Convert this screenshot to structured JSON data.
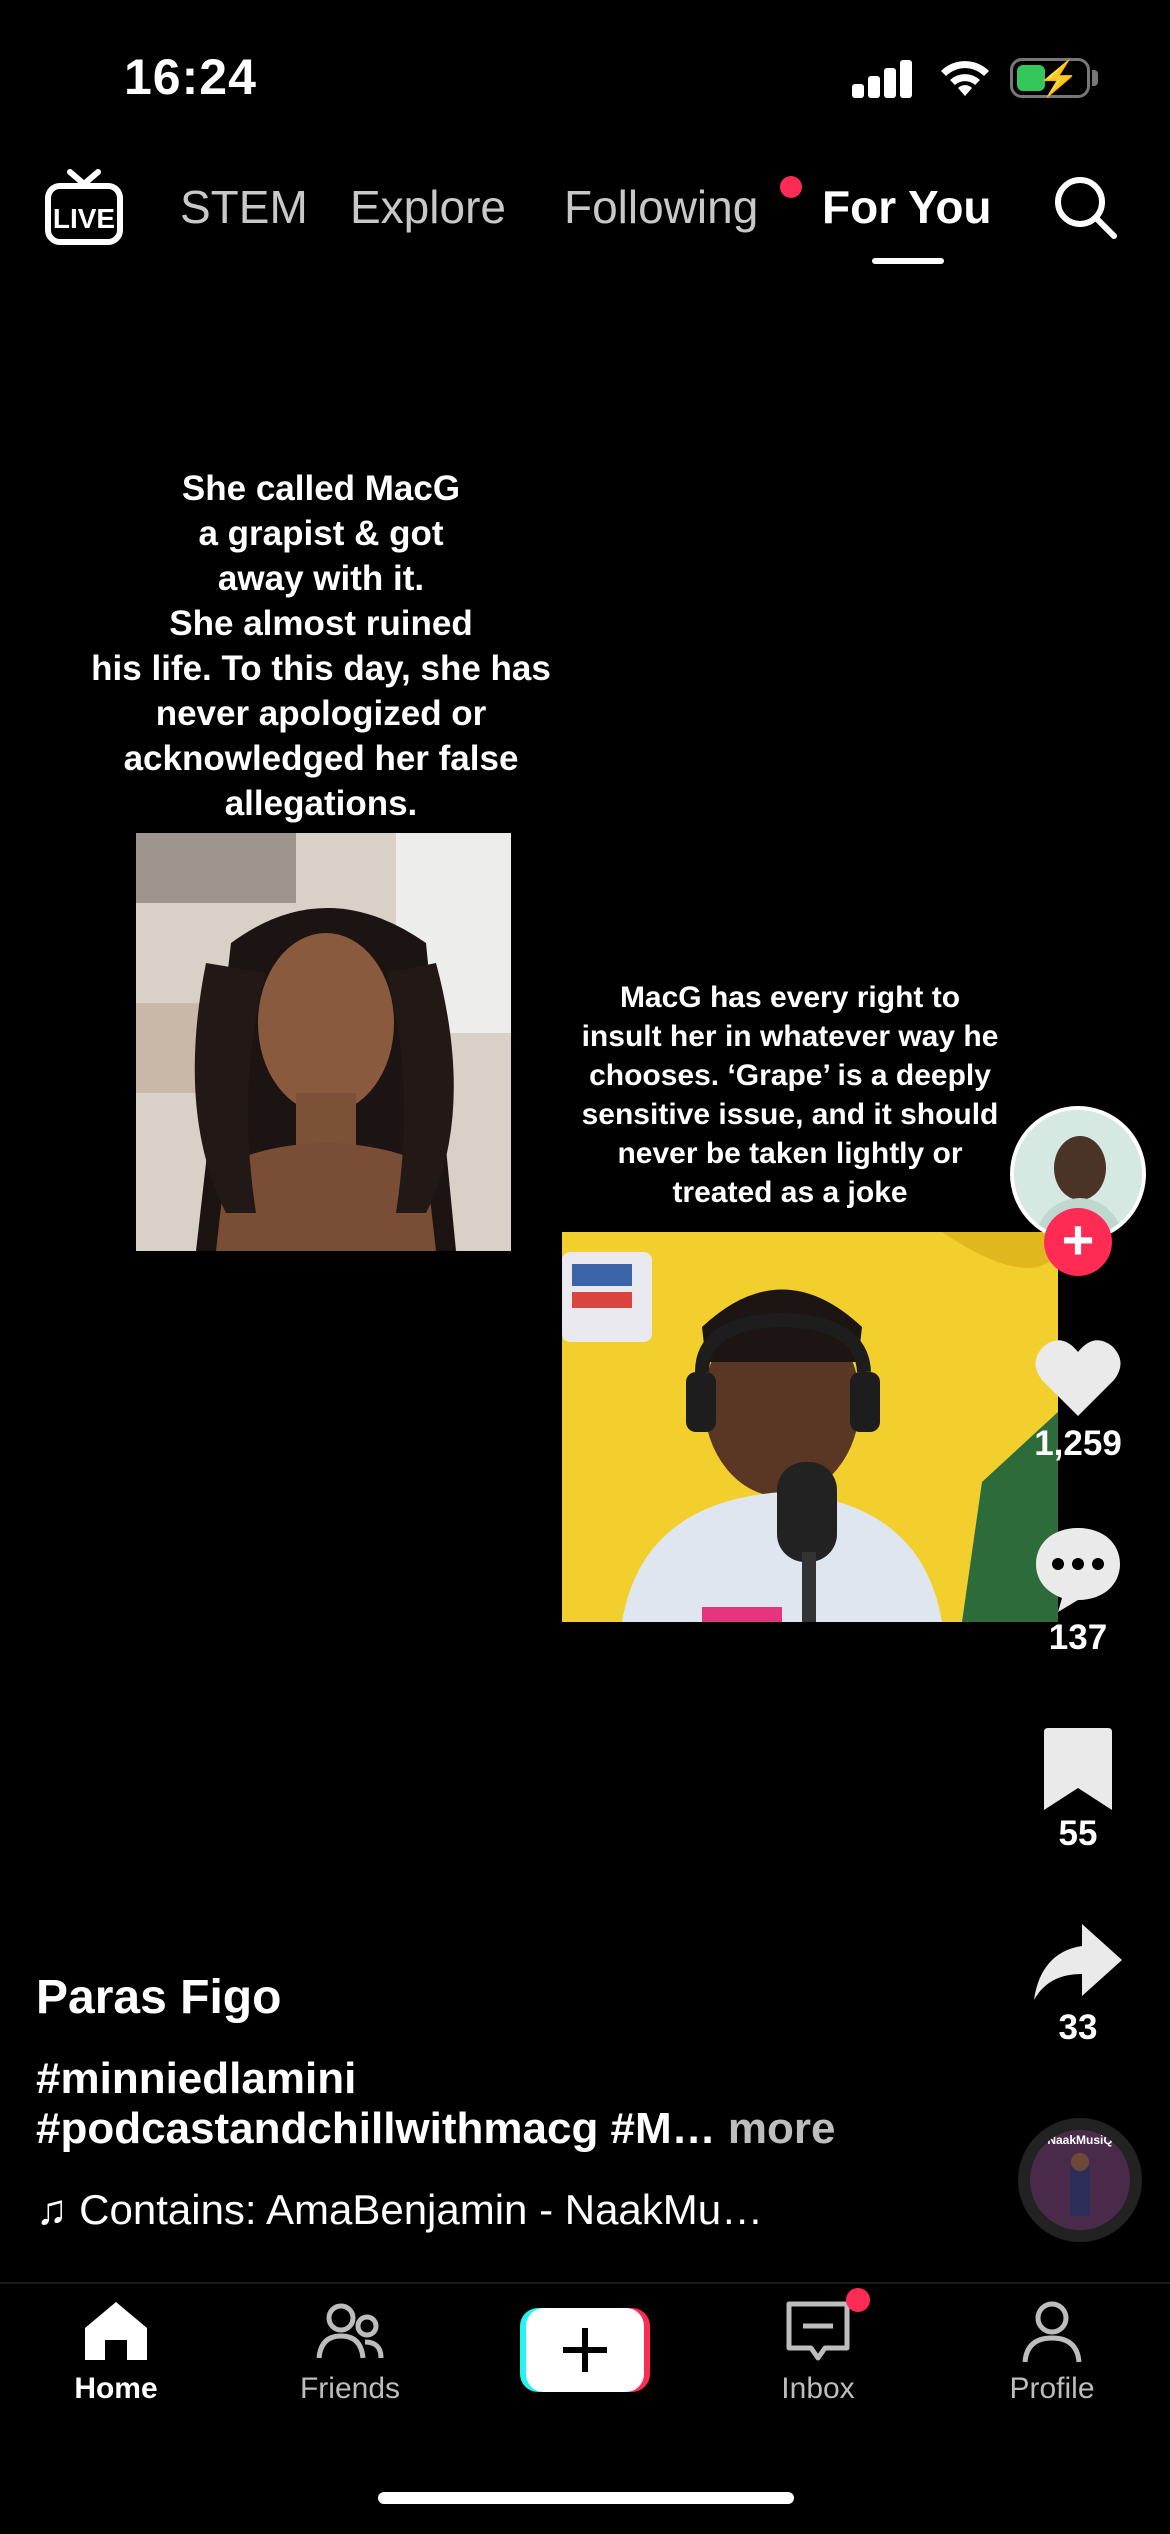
{
  "status": {
    "time": "16:24"
  },
  "top_nav": {
    "live_label": "LIVE",
    "tabs": [
      "STEM",
      "Explore",
      "Following",
      "For You"
    ],
    "active_tab": "For You"
  },
  "post": {
    "caption_left": [
      "She called MacG",
      "a grapist & got",
      "away with it.",
      "She almost ruined",
      "his life. To this day, she has",
      "never apologized or",
      "acknowledged her false",
      "allegations."
    ],
    "caption_right": [
      "MacG has every right to",
      "insult her in whatever way he",
      "chooses. ‘Grape’ is a deeply",
      "sensitive issue, and it should",
      "never be taken lightly or",
      "treated as a joke"
    ],
    "username": "Paras Figo",
    "hashtags_line1": "#minniedlamini",
    "hashtags_line2": "#podcastandchillwithmacg #M…",
    "more_label": "more",
    "sound_text": "Contains: AmaBenjamin - NaakMu…",
    "disc_label": "NaakMusiQ"
  },
  "actions": {
    "likes": "1,259",
    "comments": "137",
    "saves": "55",
    "shares": "33"
  },
  "bottom_nav": {
    "home": "Home",
    "friends": "Friends",
    "inbox": "Inbox",
    "profile": "Profile"
  },
  "colors": {
    "accent_red": "#fe2c55",
    "battery_green": "#35c759",
    "tiktok_cyan": "#25f4ee"
  }
}
